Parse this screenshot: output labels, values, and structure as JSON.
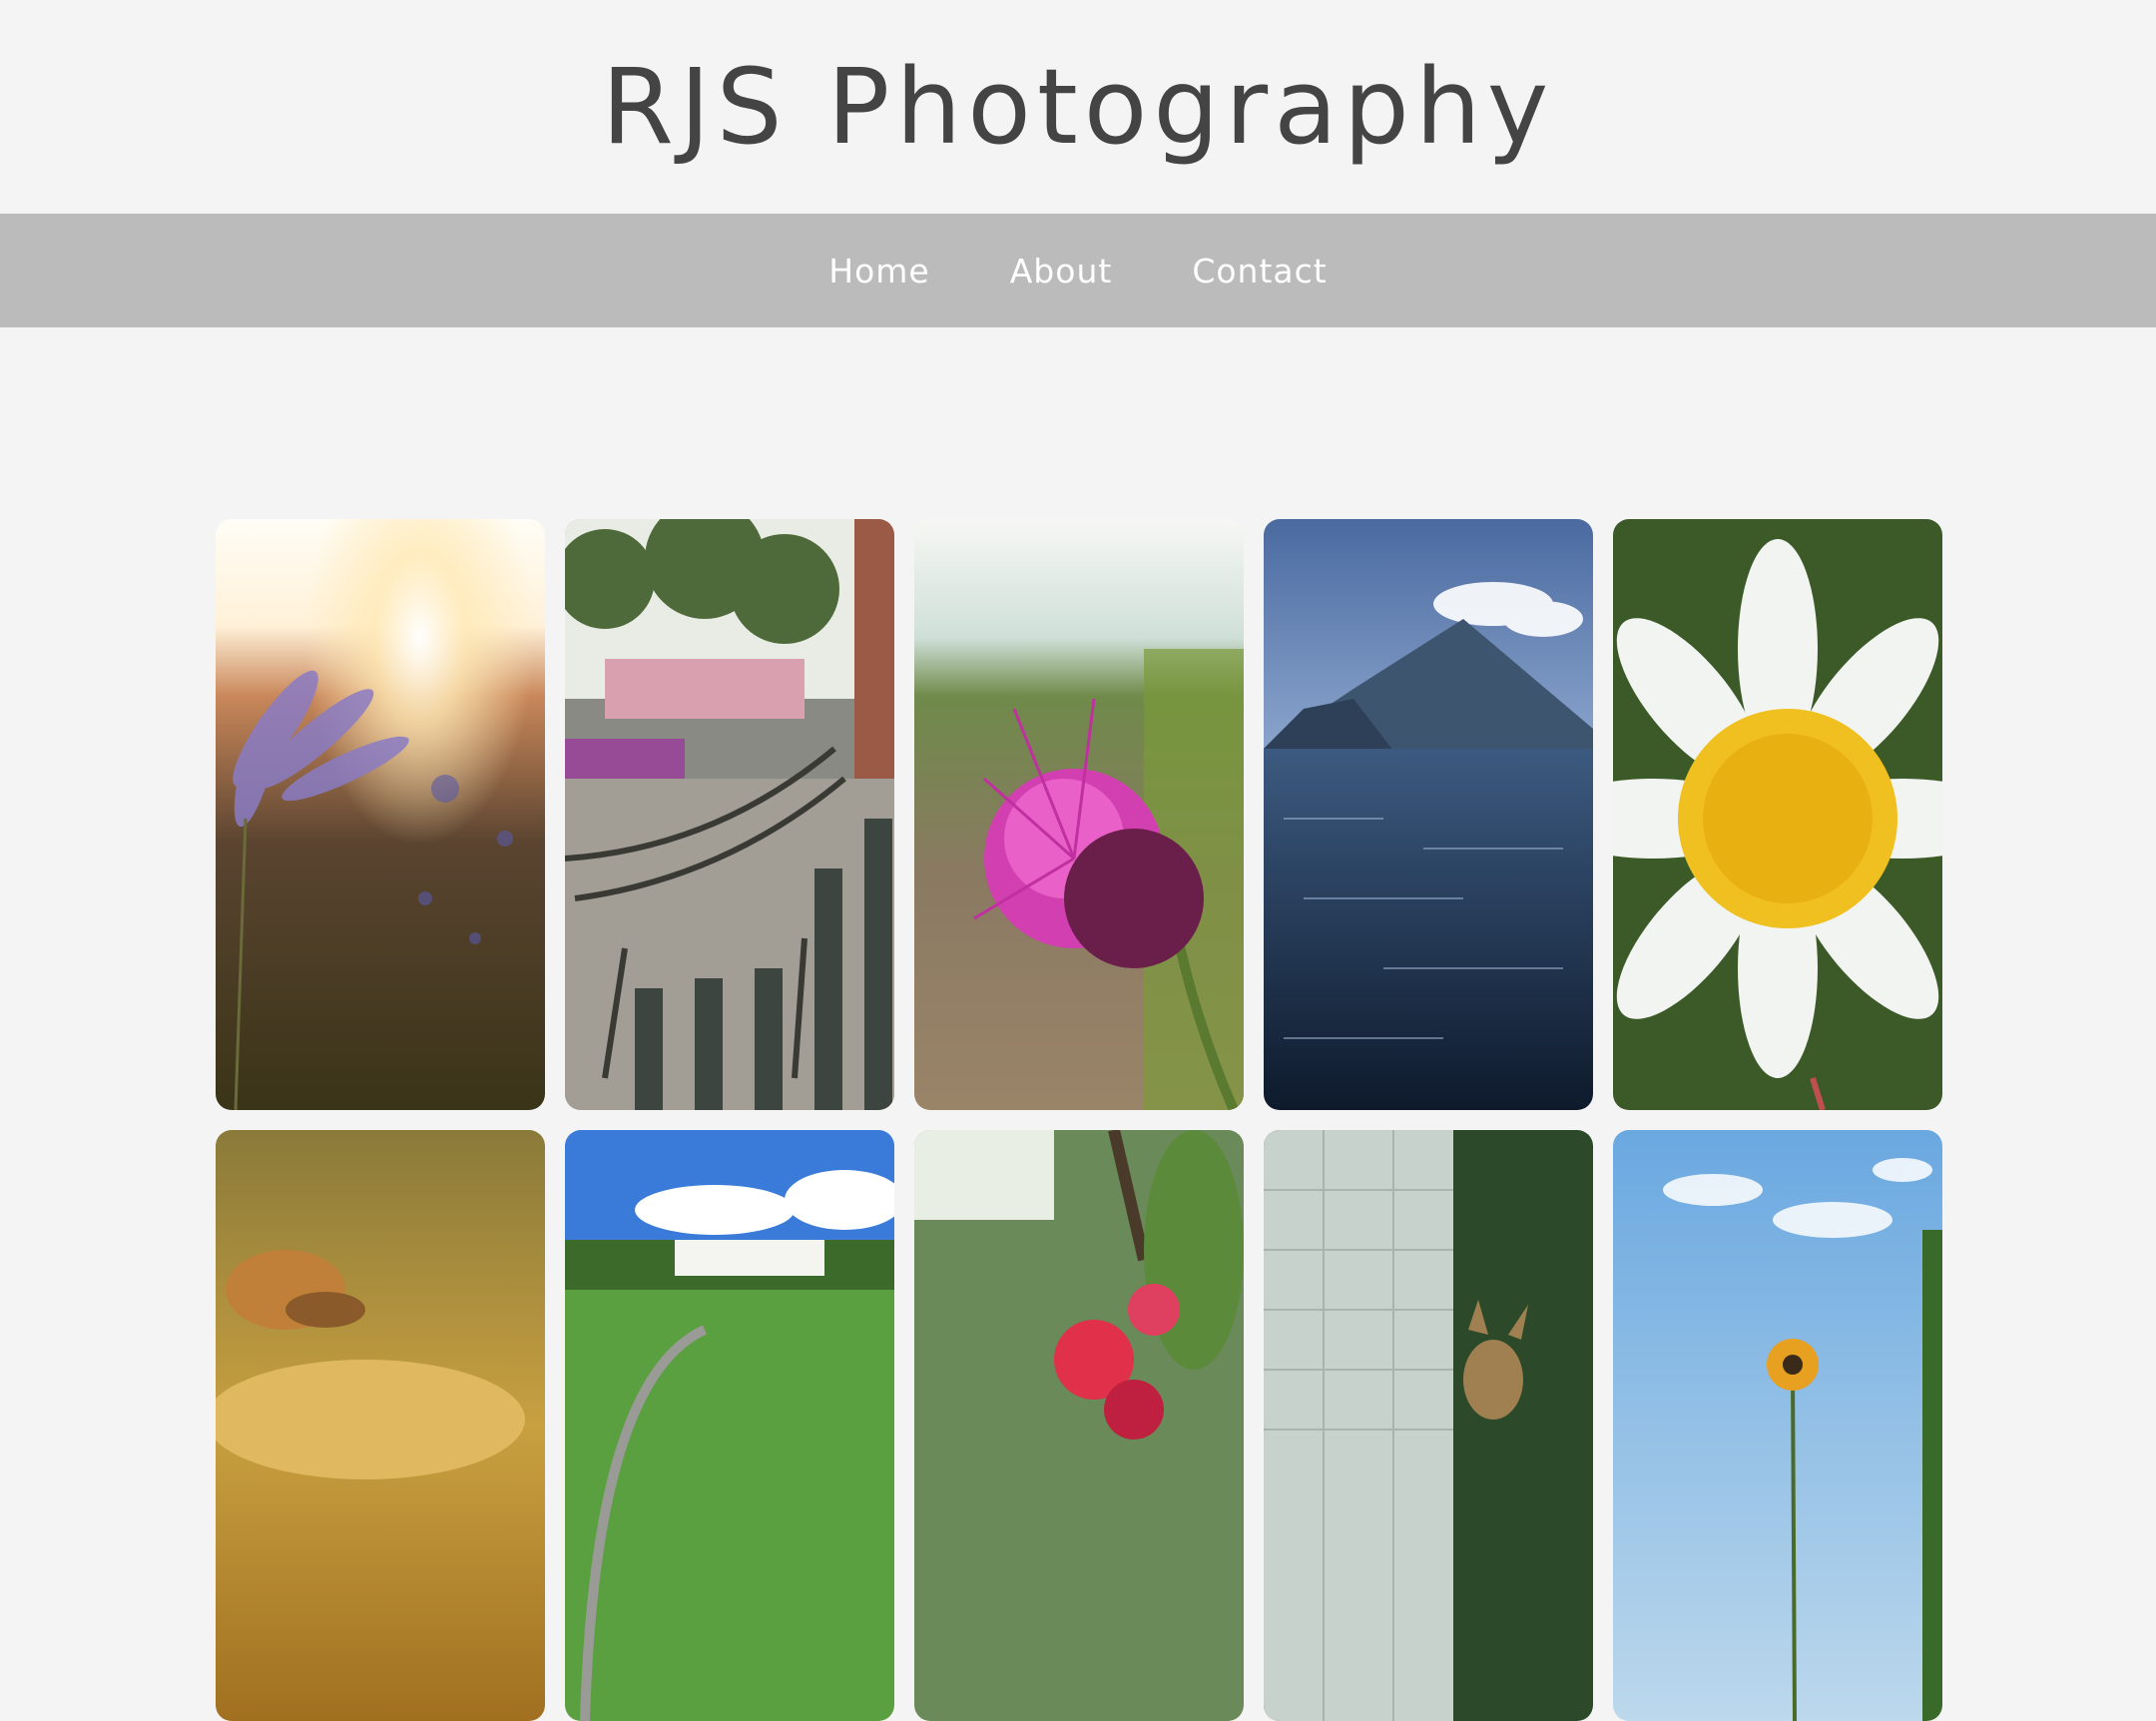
{
  "site": {
    "title": "RJS Photography"
  },
  "nav": {
    "items": [
      {
        "label": "Home"
      },
      {
        "label": "About"
      },
      {
        "label": "Contact"
      }
    ]
  },
  "gallery": {
    "photos": [
      {
        "subject": "sunlit lavender bloom"
      },
      {
        "subject": "iron park bench"
      },
      {
        "subject": "pink thistle flower"
      },
      {
        "subject": "volcano over lake"
      },
      {
        "subject": "white daisy with dew"
      },
      {
        "subject": "snail on moss"
      },
      {
        "subject": "grand hotel on golf course"
      },
      {
        "subject": "red berries"
      },
      {
        "subject": "deer by wall"
      },
      {
        "subject": "black-eyed susan under sky"
      }
    ]
  }
}
